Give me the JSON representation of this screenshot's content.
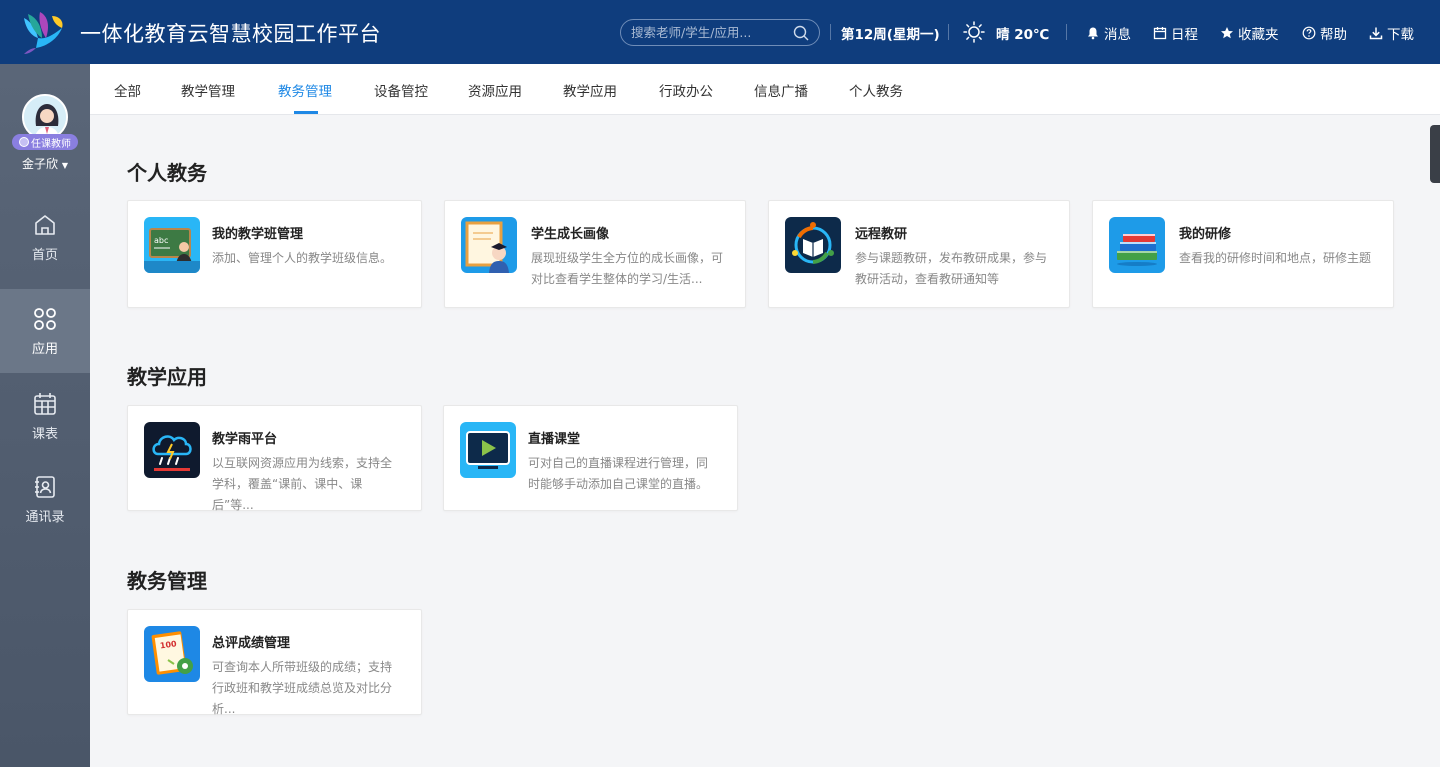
{
  "header": {
    "title": "一体化教育云智慧校园工作平台",
    "search_placeholder": "搜索老师/学生/应用...",
    "week": "第12周(星期一)",
    "weather": "晴  20℃",
    "links": {
      "messages": "消息",
      "schedule": "日程",
      "favorites": "收藏夹",
      "help": "帮助",
      "download": "下载"
    }
  },
  "user": {
    "role": "任课教师",
    "name": "金子欣"
  },
  "sidebar": {
    "items": [
      {
        "label": "首页",
        "icon": "home-icon"
      },
      {
        "label": "应用",
        "icon": "apps-icon"
      },
      {
        "label": "课表",
        "icon": "calendar-icon"
      },
      {
        "label": "通讯录",
        "icon": "contacts-icon"
      }
    ],
    "active": "应用"
  },
  "tabs": {
    "items": [
      "全部",
      "教学管理",
      "教务管理",
      "设备管控",
      "资源应用",
      "教学应用",
      "行政办公",
      "信息广播",
      "个人教务"
    ],
    "active": "教务管理"
  },
  "sections": [
    {
      "title": "个人教务",
      "cards": [
        {
          "title": "我的教学班管理",
          "desc": "添加、管理个人的教学班级信息。",
          "icon": "chalkboard-teacher-icon"
        },
        {
          "title": "学生成长画像",
          "desc": "展现班级学生全方位的成长画像，可对比查看学生整体的学习/生活...",
          "icon": "student-portrait-icon"
        },
        {
          "title": "远程教研",
          "desc": "参与课题教研，发布教研成果，参与教研活动，查看教研通知等",
          "icon": "remote-research-icon"
        },
        {
          "title": "我的研修",
          "desc": "查看我的研修时间和地点，研修主题",
          "icon": "books-icon"
        }
      ]
    },
    {
      "title": "教学应用",
      "cards": [
        {
          "title": "教学雨平台",
          "desc": "以互联网资源应用为线索，支持全学科，覆盖“课前、课中、课后”等...",
          "icon": "cloud-rain-icon"
        },
        {
          "title": "直播课堂",
          "desc": "可对自己的直播课程进行管理，同时能够手动添加自己课堂的直播。",
          "icon": "live-play-icon"
        }
      ]
    },
    {
      "title": "教务管理",
      "cards": [
        {
          "title": "总评成绩管理",
          "desc": "可查询本人所带班级的成绩；支持行政班和教学班成绩总览及对比分析...",
          "icon": "score-sheet-icon"
        }
      ]
    }
  ],
  "colors": {
    "header_bg": "#0f3d7d",
    "accent": "#1e88e5",
    "sidebar_bg": "#55616f"
  }
}
